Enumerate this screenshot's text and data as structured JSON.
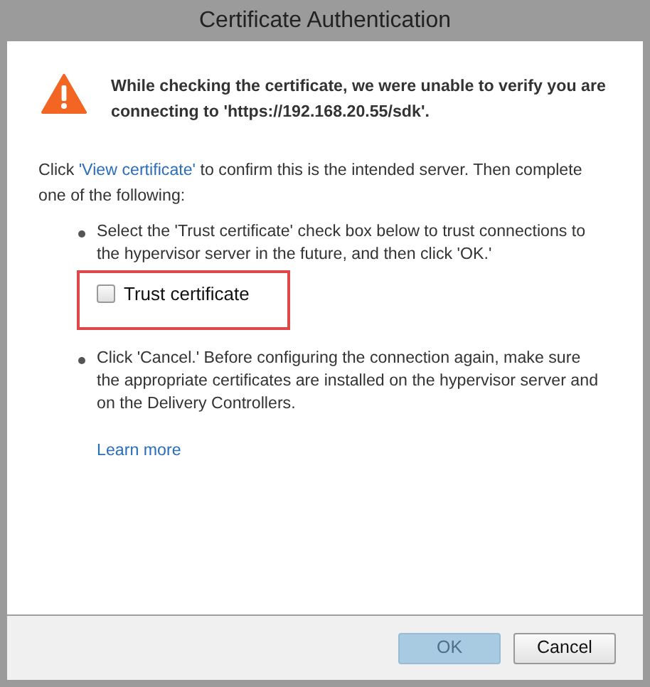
{
  "window": {
    "title": "Certificate Authentication"
  },
  "warning": "While checking the certificate, we were unable to verify you are connecting to 'https://192.168.20.55/sdk'.",
  "intro": {
    "before": "Click ",
    "link": "'View certificate'",
    "after": " to confirm this is the intended server. Then complete one of the following:"
  },
  "options": [
    {
      "text": "Select the 'Trust certificate' check box below to trust connections to the hypervisor server in the future, and then click 'OK.'",
      "checkbox": {
        "label": "Trust certificate",
        "checked": false,
        "highlighted": true
      }
    },
    {
      "text": "Click 'Cancel.' Before configuring the connection again, make sure the appropriate certificates are installed on the hypervisor server and on the Delivery Controllers."
    }
  ],
  "learn_more": "Learn more",
  "buttons": [
    {
      "label": "OK",
      "disabled": true
    },
    {
      "label": "Cancel",
      "disabled": false
    }
  ]
}
